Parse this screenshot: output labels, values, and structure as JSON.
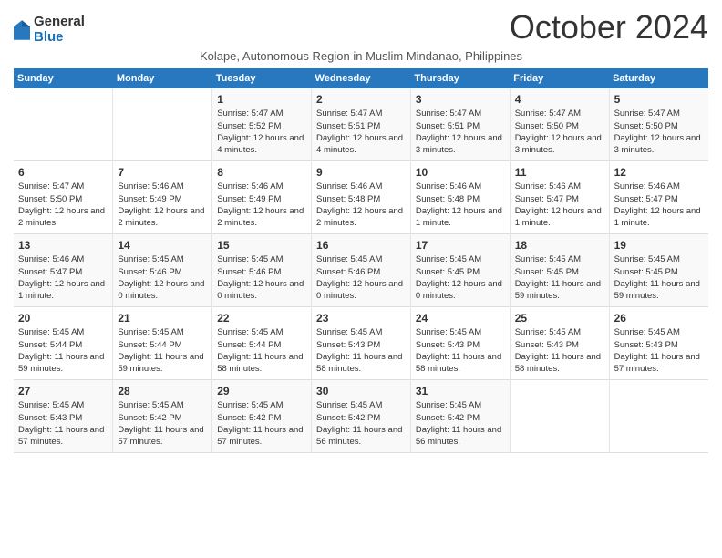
{
  "logo": {
    "general": "General",
    "blue": "Blue"
  },
  "title": "October 2024",
  "subtitle": "Kolape, Autonomous Region in Muslim Mindanao, Philippines",
  "days_of_week": [
    "Sunday",
    "Monday",
    "Tuesday",
    "Wednesday",
    "Thursday",
    "Friday",
    "Saturday"
  ],
  "weeks": [
    [
      {
        "day": "",
        "info": ""
      },
      {
        "day": "",
        "info": ""
      },
      {
        "day": "1",
        "info": "Sunrise: 5:47 AM\nSunset: 5:52 PM\nDaylight: 12 hours and 4 minutes."
      },
      {
        "day": "2",
        "info": "Sunrise: 5:47 AM\nSunset: 5:51 PM\nDaylight: 12 hours and 4 minutes."
      },
      {
        "day": "3",
        "info": "Sunrise: 5:47 AM\nSunset: 5:51 PM\nDaylight: 12 hours and 3 minutes."
      },
      {
        "day": "4",
        "info": "Sunrise: 5:47 AM\nSunset: 5:50 PM\nDaylight: 12 hours and 3 minutes."
      },
      {
        "day": "5",
        "info": "Sunrise: 5:47 AM\nSunset: 5:50 PM\nDaylight: 12 hours and 3 minutes."
      }
    ],
    [
      {
        "day": "6",
        "info": "Sunrise: 5:47 AM\nSunset: 5:50 PM\nDaylight: 12 hours and 2 minutes."
      },
      {
        "day": "7",
        "info": "Sunrise: 5:46 AM\nSunset: 5:49 PM\nDaylight: 12 hours and 2 minutes."
      },
      {
        "day": "8",
        "info": "Sunrise: 5:46 AM\nSunset: 5:49 PM\nDaylight: 12 hours and 2 minutes."
      },
      {
        "day": "9",
        "info": "Sunrise: 5:46 AM\nSunset: 5:48 PM\nDaylight: 12 hours and 2 minutes."
      },
      {
        "day": "10",
        "info": "Sunrise: 5:46 AM\nSunset: 5:48 PM\nDaylight: 12 hours and 1 minute."
      },
      {
        "day": "11",
        "info": "Sunrise: 5:46 AM\nSunset: 5:47 PM\nDaylight: 12 hours and 1 minute."
      },
      {
        "day": "12",
        "info": "Sunrise: 5:46 AM\nSunset: 5:47 PM\nDaylight: 12 hours and 1 minute."
      }
    ],
    [
      {
        "day": "13",
        "info": "Sunrise: 5:46 AM\nSunset: 5:47 PM\nDaylight: 12 hours and 1 minute."
      },
      {
        "day": "14",
        "info": "Sunrise: 5:45 AM\nSunset: 5:46 PM\nDaylight: 12 hours and 0 minutes."
      },
      {
        "day": "15",
        "info": "Sunrise: 5:45 AM\nSunset: 5:46 PM\nDaylight: 12 hours and 0 minutes."
      },
      {
        "day": "16",
        "info": "Sunrise: 5:45 AM\nSunset: 5:46 PM\nDaylight: 12 hours and 0 minutes."
      },
      {
        "day": "17",
        "info": "Sunrise: 5:45 AM\nSunset: 5:45 PM\nDaylight: 12 hours and 0 minutes."
      },
      {
        "day": "18",
        "info": "Sunrise: 5:45 AM\nSunset: 5:45 PM\nDaylight: 11 hours and 59 minutes."
      },
      {
        "day": "19",
        "info": "Sunrise: 5:45 AM\nSunset: 5:45 PM\nDaylight: 11 hours and 59 minutes."
      }
    ],
    [
      {
        "day": "20",
        "info": "Sunrise: 5:45 AM\nSunset: 5:44 PM\nDaylight: 11 hours and 59 minutes."
      },
      {
        "day": "21",
        "info": "Sunrise: 5:45 AM\nSunset: 5:44 PM\nDaylight: 11 hours and 59 minutes."
      },
      {
        "day": "22",
        "info": "Sunrise: 5:45 AM\nSunset: 5:44 PM\nDaylight: 11 hours and 58 minutes."
      },
      {
        "day": "23",
        "info": "Sunrise: 5:45 AM\nSunset: 5:43 PM\nDaylight: 11 hours and 58 minutes."
      },
      {
        "day": "24",
        "info": "Sunrise: 5:45 AM\nSunset: 5:43 PM\nDaylight: 11 hours and 58 minutes."
      },
      {
        "day": "25",
        "info": "Sunrise: 5:45 AM\nSunset: 5:43 PM\nDaylight: 11 hours and 58 minutes."
      },
      {
        "day": "26",
        "info": "Sunrise: 5:45 AM\nSunset: 5:43 PM\nDaylight: 11 hours and 57 minutes."
      }
    ],
    [
      {
        "day": "27",
        "info": "Sunrise: 5:45 AM\nSunset: 5:43 PM\nDaylight: 11 hours and 57 minutes."
      },
      {
        "day": "28",
        "info": "Sunrise: 5:45 AM\nSunset: 5:42 PM\nDaylight: 11 hours and 57 minutes."
      },
      {
        "day": "29",
        "info": "Sunrise: 5:45 AM\nSunset: 5:42 PM\nDaylight: 11 hours and 57 minutes."
      },
      {
        "day": "30",
        "info": "Sunrise: 5:45 AM\nSunset: 5:42 PM\nDaylight: 11 hours and 56 minutes."
      },
      {
        "day": "31",
        "info": "Sunrise: 5:45 AM\nSunset: 5:42 PM\nDaylight: 11 hours and 56 minutes."
      },
      {
        "day": "",
        "info": ""
      },
      {
        "day": "",
        "info": ""
      }
    ]
  ]
}
